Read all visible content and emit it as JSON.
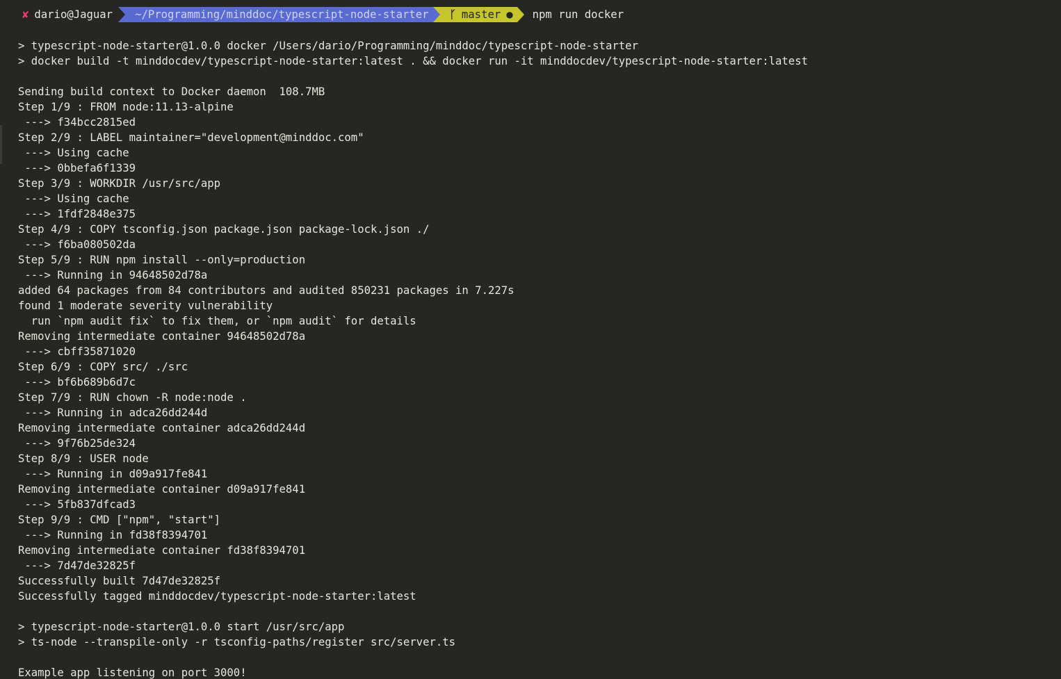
{
  "prompt": {
    "status_icon": "✘",
    "user_host": "dario@Jaguar",
    "path": "~/Programming/minddoc/typescript-node-starter",
    "branch_icon": "ᚴ",
    "branch": "master",
    "dirty_marker": "●",
    "command": "npm run docker"
  },
  "output_lines": [
    "> typescript-node-starter@1.0.0 docker /Users/dario/Programming/minddoc/typescript-node-starter",
    "> docker build -t minddocdev/typescript-node-starter:latest . && docker run -it minddocdev/typescript-node-starter:latest",
    "",
    "Sending build context to Docker daemon  108.7MB",
    "Step 1/9 : FROM node:11.13-alpine",
    " ---> f34bcc2815ed",
    "Step 2/9 : LABEL maintainer=\"development@minddoc.com\"",
    " ---> Using cache",
    " ---> 0bbefa6f1339",
    "Step 3/9 : WORKDIR /usr/src/app",
    " ---> Using cache",
    " ---> 1fdf2848e375",
    "Step 4/9 : COPY tsconfig.json package.json package-lock.json ./",
    " ---> f6ba080502da",
    "Step 5/9 : RUN npm install --only=production",
    " ---> Running in 94648502d78a",
    "added 64 packages from 84 contributors and audited 850231 packages in 7.227s",
    "found 1 moderate severity vulnerability",
    "  run `npm audit fix` to fix them, or `npm audit` for details",
    "Removing intermediate container 94648502d78a",
    " ---> cbff35871020",
    "Step 6/9 : COPY src/ ./src",
    " ---> bf6b689b6d7c",
    "Step 7/9 : RUN chown -R node:node .",
    " ---> Running in adca26dd244d",
    "Removing intermediate container adca26dd244d",
    " ---> 9f76b25de324",
    "Step 8/9 : USER node",
    " ---> Running in d09a917fe841",
    "Removing intermediate container d09a917fe841",
    " ---> 5fb837dfcad3",
    "Step 9/9 : CMD [\"npm\", \"start\"]",
    " ---> Running in fd38f8394701",
    "Removing intermediate container fd38f8394701",
    " ---> 7d47de32825f",
    "Successfully built 7d47de32825f",
    "Successfully tagged minddocdev/typescript-node-starter:latest",
    "",
    "> typescript-node-starter@1.0.0 start /usr/src/app",
    "> ts-node --transpile-only -r tsconfig-paths/register src/server.ts",
    "",
    "Example app listening on port 3000!"
  ],
  "colors": {
    "background": "#262722",
    "foreground": "#e6e6df",
    "error": "#f5396f",
    "path_segment": "#5a6ad3",
    "git_segment": "#c6c62a"
  }
}
